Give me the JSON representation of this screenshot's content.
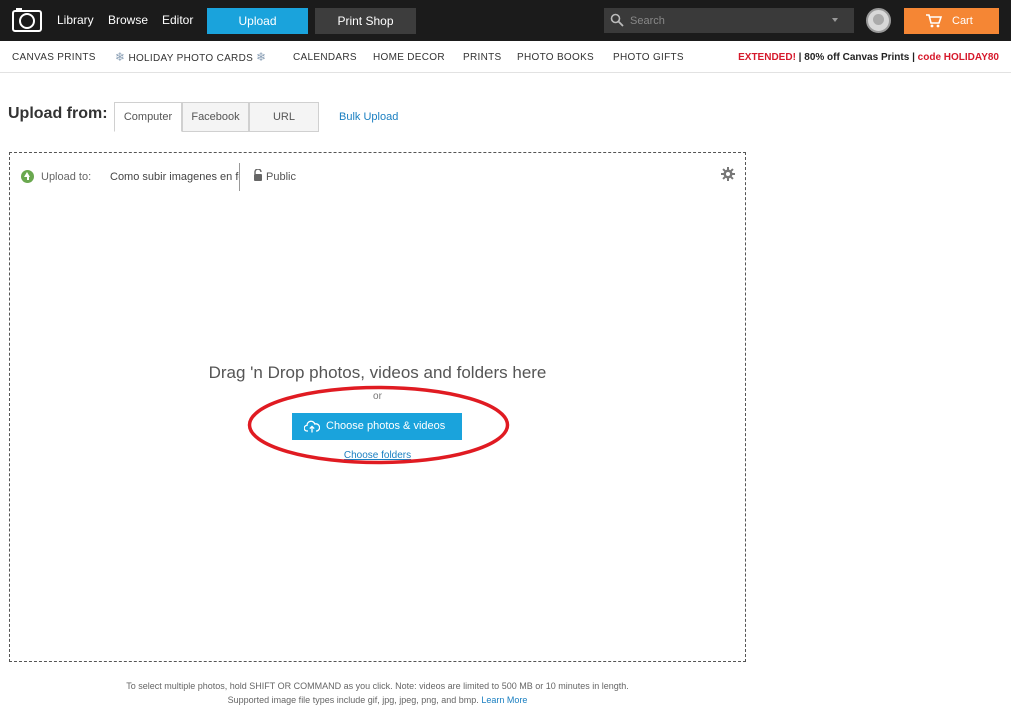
{
  "topbar": {
    "nav": {
      "library": "Library",
      "browse": "Browse",
      "editor": "Editor"
    },
    "upload_label": "Upload",
    "printshop_label": "Print Shop",
    "search_placeholder": "Search",
    "cart_label": "Cart",
    "colors": {
      "bar": "#1b1b1b",
      "upload": "#1aa3dc",
      "cart": "#f58634"
    }
  },
  "subnav": {
    "items": [
      "CANVAS PRINTS",
      "HOLIDAY PHOTO CARDS",
      "CALENDARS",
      "HOME DECOR",
      "PRINTS",
      "PHOTO BOOKS",
      "PHOTO GIFTS"
    ],
    "promo": {
      "extended": "EXTENDED!",
      "sep1": " | ",
      "offer": "80% off Canvas Prints",
      "sep2": " | ",
      "code": "code HOLIDAY80"
    },
    "promo_color": "#d6192b"
  },
  "upload": {
    "from_label": "Upload from:",
    "tabs": [
      "Computer",
      "Facebook",
      "URL"
    ],
    "active_tab": "Computer",
    "bulk_upload": "Bulk Upload"
  },
  "dropzone": {
    "upload_to_label": "Upload to:",
    "album_name": "Como subir imagenes en foro",
    "privacy": "Public",
    "title": "Drag 'n Drop photos, videos and folders here",
    "or": "or",
    "choose_button": "Choose photos & videos",
    "choose_folders": "Choose folders",
    "highlight_color": "#e01b22"
  },
  "footer": {
    "note1": "To select multiple photos, hold SHIFT OR COMMAND as you click. Note: videos are limited to 500 MB or 10 minutes in length.",
    "note2": "Supported image file types include gif, jpg, jpeg, png, and bmp.",
    "learn_more": "Learn More"
  }
}
